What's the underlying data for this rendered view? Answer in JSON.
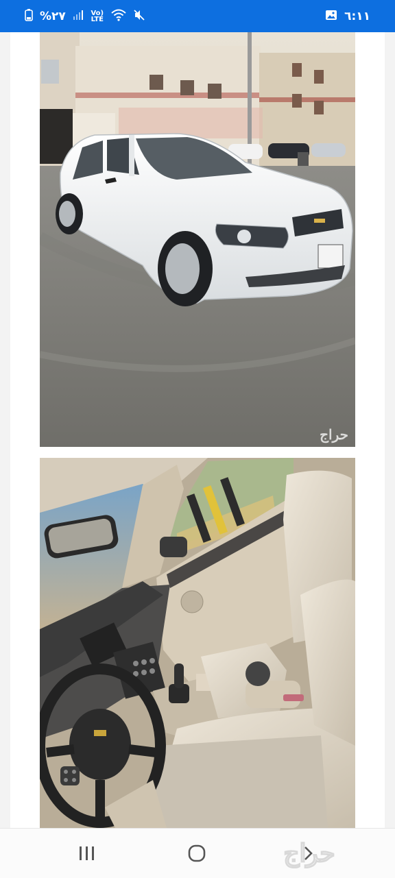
{
  "status_bar": {
    "battery_percent": "%٢٧",
    "network_label": "Vo) LTE",
    "time": "٦:١١"
  },
  "photos": [
    {
      "subject": "White Chevrolet sedan parked on a gravel lot in front of residential buildings",
      "watermark": "حراج"
    },
    {
      "subject": "Car interior: beige front seats, steering wheel and dashboard"
    }
  ],
  "nav_bar": {
    "recents_icon": "recents-icon",
    "home_icon": "home-icon",
    "back_icon": "back-icon",
    "logo": "حراج"
  }
}
